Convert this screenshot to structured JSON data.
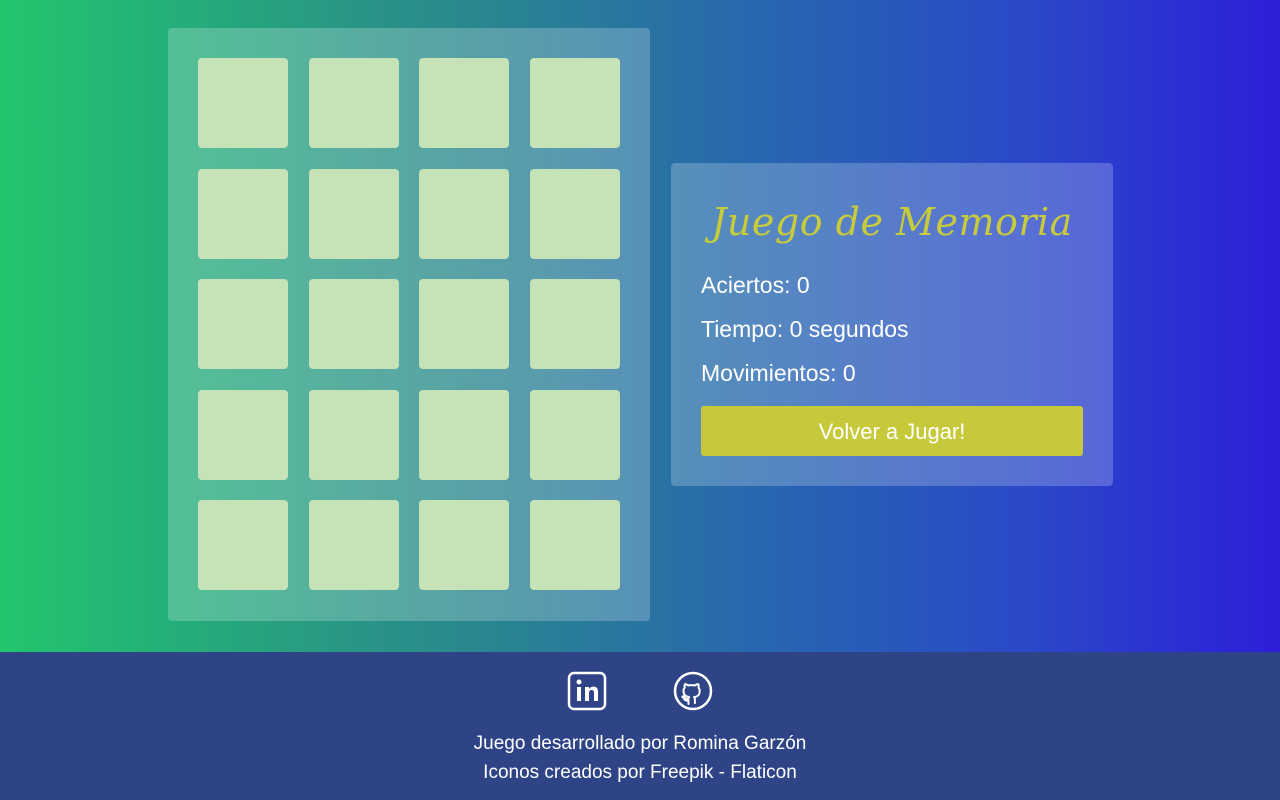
{
  "game": {
    "title": "Juego de Memoria",
    "stats": {
      "aciertos": "Aciertos: 0",
      "tiempo": "Tiempo: 0 segundos",
      "movimientos": "Movimientos: 0"
    },
    "replay_label": "Volver a Jugar!",
    "board": {
      "rows": 5,
      "cols": 4,
      "card_state": "face-down"
    }
  },
  "footer": {
    "social": [
      "linkedin-icon",
      "github-icon"
    ],
    "credit_line": "Juego desarrollado por Romina Garzón",
    "icons_credit": "Iconos creados por Freepik - Flaticon"
  },
  "colors": {
    "gradient_start": "#22c56d",
    "gradient_end": "#2d1ed8",
    "card": "#c5e3b7",
    "title": "#c9cc3a",
    "button": "#c6c93a",
    "footer": "#2e4486"
  }
}
